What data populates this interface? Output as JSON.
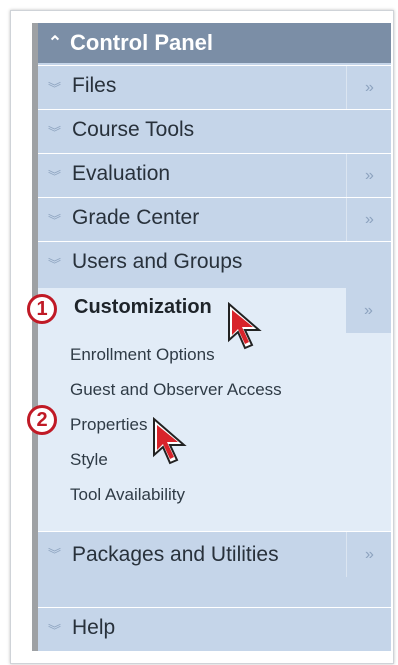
{
  "panel": {
    "title": "Control Panel",
    "items": [
      {
        "label": "Files",
        "has_arrow": true
      },
      {
        "label": "Course Tools",
        "has_arrow": false
      },
      {
        "label": "Evaluation",
        "has_arrow": true
      },
      {
        "label": "Grade Center",
        "has_arrow": true
      },
      {
        "label": "Users and Groups",
        "has_arrow": false
      }
    ],
    "expanded": {
      "label": "Customization",
      "subitems": [
        "Enrollment Options",
        "Guest and Observer Access",
        "Properties",
        "Style",
        "Tool Availability"
      ]
    },
    "after": [
      {
        "label": "Packages and Utilities",
        "has_arrow": true
      },
      {
        "label": "Help",
        "has_arrow": false
      }
    ]
  },
  "annotations": {
    "badge1": "1",
    "badge2": "2"
  },
  "glyphs": {
    "collapse": "⌃",
    "chevron": "≫",
    "double_down": "≚"
  }
}
